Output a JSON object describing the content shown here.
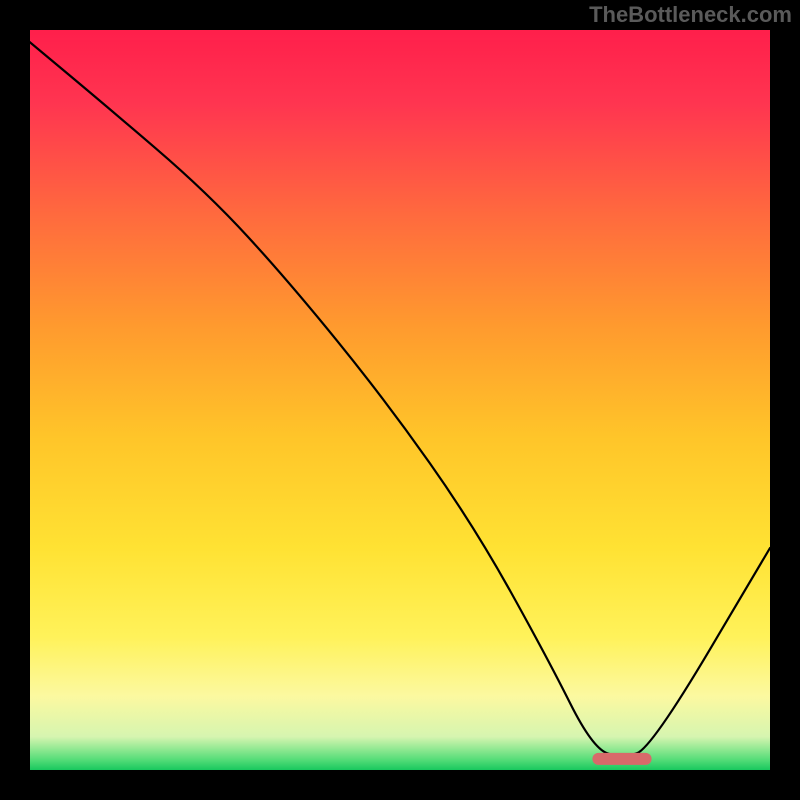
{
  "watermark": "TheBottleneck.com",
  "colors": {
    "marker": "#d86a6a",
    "curve": "#000000",
    "background_black": "#000000"
  },
  "chart_data": {
    "type": "line",
    "title": "",
    "xlabel": "",
    "ylabel": "",
    "xlim": [
      0,
      100
    ],
    "ylim": [
      0,
      100
    ],
    "grid": false,
    "legend": false,
    "series": [
      {
        "name": "bottleneck_curve",
        "x": [
          -2,
          10,
          24,
          35,
          48,
          60,
          70,
          76,
          80,
          84,
          100
        ],
        "y": [
          100,
          90,
          78,
          66,
          50,
          33,
          15,
          3,
          1.5,
          3,
          30
        ]
      }
    ],
    "optimal_range": {
      "x_start": 76,
      "x_end": 84,
      "y": 1.5
    },
    "annotations": []
  }
}
